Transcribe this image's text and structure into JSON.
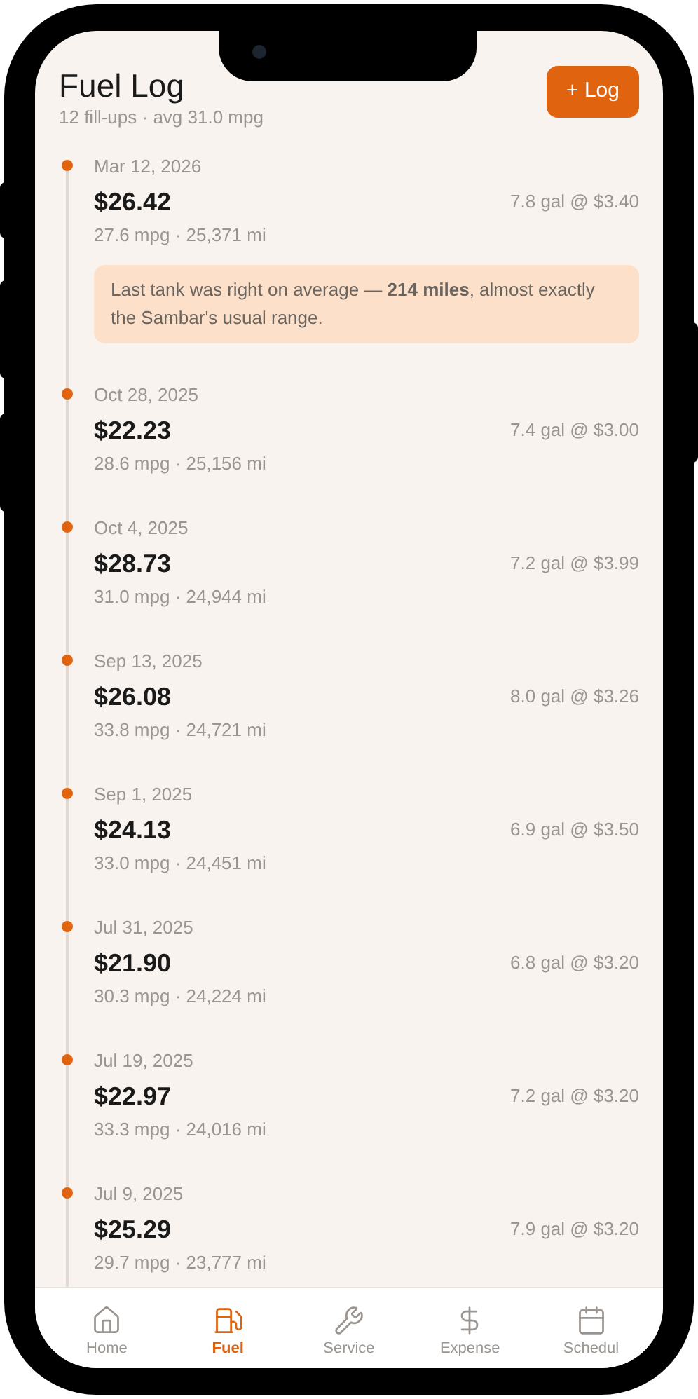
{
  "header": {
    "title": "Fuel Log",
    "subtitle": "12 fill-ups · avg 31.0 mpg",
    "add_button": "+ Log"
  },
  "entries": [
    {
      "date": "Mar 12, 2026",
      "amount": "$26.42",
      "volume": "7.8 gal @ $3.40",
      "stats": "27.6 mpg · 25,371 mi",
      "note": "Last tank was right on average — **214 miles**, almost exactly the Sambar's usual range."
    },
    {
      "date": "Oct 28, 2025",
      "amount": "$22.23",
      "volume": "7.4 gal @ $3.00",
      "stats": "28.6 mpg · 25,156 mi"
    },
    {
      "date": "Oct 4, 2025",
      "amount": "$28.73",
      "volume": "7.2 gal @ $3.99",
      "stats": "31.0 mpg · 24,944 mi"
    },
    {
      "date": "Sep 13, 2025",
      "amount": "$26.08",
      "volume": "8.0 gal @ $3.26",
      "stats": "33.8 mpg · 24,721 mi"
    },
    {
      "date": "Sep 1, 2025",
      "amount": "$24.13",
      "volume": "6.9 gal @ $3.50",
      "stats": "33.0 mpg · 24,451 mi"
    },
    {
      "date": "Jul 31, 2025",
      "amount": "$21.90",
      "volume": "6.8 gal @ $3.20",
      "stats": "30.3 mpg · 24,224 mi"
    },
    {
      "date": "Jul 19, 2025",
      "amount": "$22.97",
      "volume": "7.2 gal @ $3.20",
      "stats": "33.3 mpg · 24,016 mi"
    },
    {
      "date": "Jul 9, 2025",
      "amount": "$25.29",
      "volume": "7.9 gal @ $3.20",
      "stats": "29.7 mpg · 23,777 mi"
    }
  ],
  "nav": [
    {
      "label": "Home",
      "selected": false
    },
    {
      "label": "Fuel",
      "selected": true
    },
    {
      "label": "Service",
      "selected": false
    },
    {
      "label": "Expense",
      "selected": false
    },
    {
      "label": "Schedul",
      "selected": false
    }
  ]
}
